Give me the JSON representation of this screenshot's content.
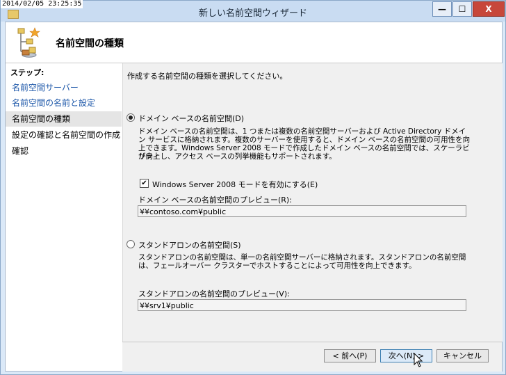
{
  "window": {
    "timestamp": "2014/02/05 23:25:35",
    "title": "新しい名前空間ウィザード"
  },
  "header": {
    "title": "名前空間の種類"
  },
  "sidebar": {
    "heading": "ステップ:",
    "items": [
      {
        "label": "名前空間サーバー",
        "state": "done"
      },
      {
        "label": "名前空間の名前と設定",
        "state": "done"
      },
      {
        "label": "名前空間の種類",
        "state": "current"
      },
      {
        "label": "設定の確認と名前空間の作成",
        "state": "pending"
      },
      {
        "label": "確認",
        "state": "pending"
      }
    ]
  },
  "main": {
    "instruction": "作成する名前空間の種類を選択してください。",
    "domain": {
      "label": "ドメイン ベースの名前空間(D)",
      "selected": true,
      "desc1": "ドメイン ベースの名前空間は、1 つまたは複数の名前空間サーバーおよび Active Directory ドメイ",
      "desc2": "ン サービスに格納されます。複数のサーバーを使用すると、ドメイン ベースの名前空間の可用性を向",
      "desc3": "上できます。Windows Server 2008 モードで作成したドメイン ベースの名前空間では、スケーラビリティ",
      "desc4": "が向上し、アクセス ベースの列挙機能もサポートされます。",
      "checkbox_label": "Windows Server 2008 モードを有効にする(E)",
      "checkbox_checked": true,
      "preview_label": "ドメイン ベースの名前空間のプレビュー(R):",
      "preview_value": "¥¥contoso.com¥public"
    },
    "standalone": {
      "label": "スタンドアロンの名前空間(S)",
      "selected": false,
      "desc1": "スタンドアロンの名前空間は、単一の名前空間サーバーに格納されます。スタンドアロンの名前空間",
      "desc2": "は、フェールオーバー クラスターでホストすることによって可用性を向上できます。",
      "preview_label": "スタンドアロンの名前空間のプレビュー(V):",
      "preview_value": "¥¥srv1¥public"
    }
  },
  "buttons": {
    "back": "< 前へ(P)",
    "next": "次へ(N) >",
    "cancel": "キャンセル"
  },
  "controls": {
    "minimize": "—",
    "maximize": "☐",
    "close": "X"
  }
}
